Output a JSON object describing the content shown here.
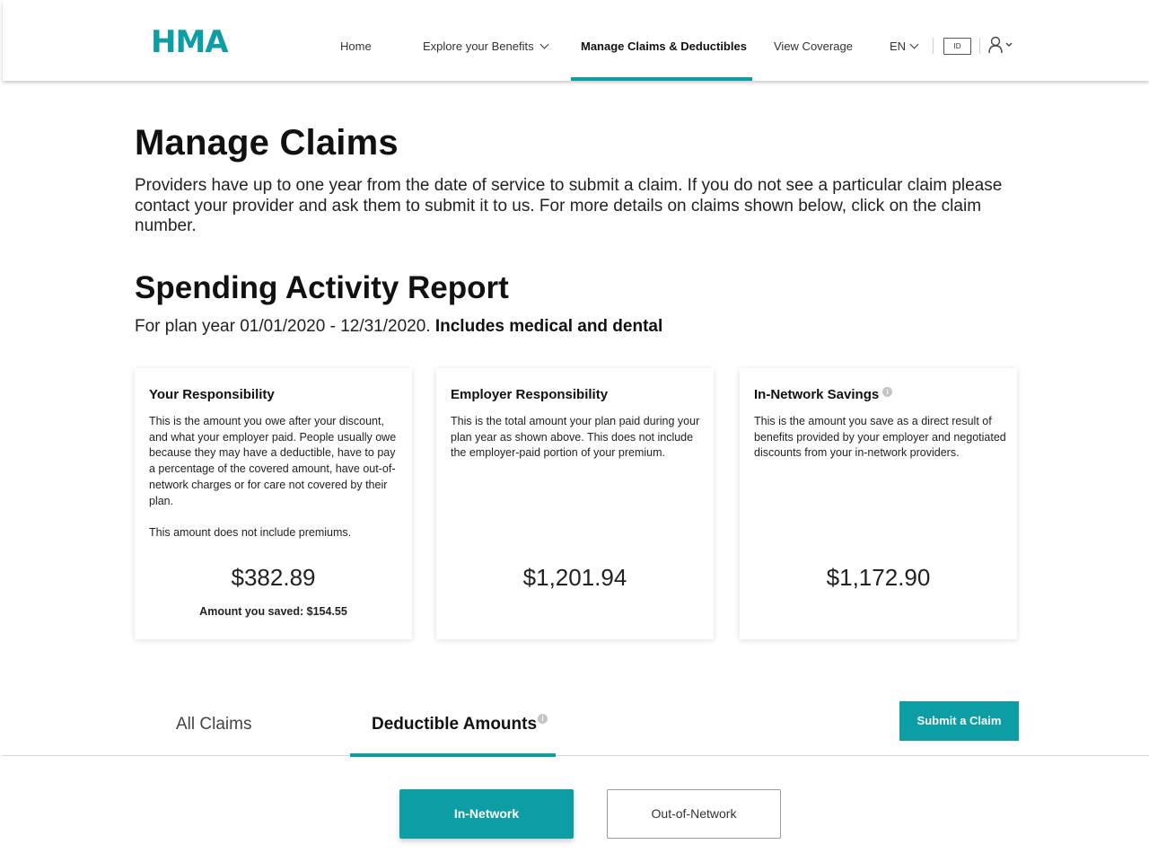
{
  "brand": {
    "logo_text": "HMA",
    "accent_color": "#0d9ea5"
  },
  "nav": {
    "items": [
      {
        "label": "Home"
      },
      {
        "label": "Explore your Benefits",
        "icon": "chevron-down-icon"
      },
      {
        "label": "Manage Claims & Deductibles",
        "active": true
      },
      {
        "label": "View Coverage"
      }
    ],
    "language": {
      "label": "EN",
      "icon": "chevron-down-icon"
    },
    "id_card_label": "ID",
    "user_icon": "user-icon"
  },
  "page": {
    "title": "Manage Claims",
    "intro": "Providers have up to one year from the date of service to submit a claim. If you do not see a particular claim please contact your provider and ask them to submit it to us. For more details on claims shown below, click on the claim number."
  },
  "report": {
    "title": "Spending Activity Report",
    "plan_prefix": "For plan year 01/01/2020 - 12/31/2020.",
    "plan_suffix": "Includes medical and dental"
  },
  "cards": [
    {
      "title": "Your Responsibility",
      "description": "This is the amount you owe after your discount, and what your employer paid. People usually owe because they may have a deductible, have to pay a percentage of the covered amount, have out-of-network charges or for care not covered by their plan.",
      "note": "This amount does not include premiums.",
      "amount": "$382.89",
      "saved": "Amount you saved: $154.55"
    },
    {
      "title": "Employer Responsibility",
      "description": "This is the total amount your plan paid during your plan year as shown above. This does not include the employer-paid portion of your premium.",
      "amount": "$1,201.94"
    },
    {
      "title": "In-Network Savings",
      "info_icon": "info-icon",
      "description": "This is the amount you save as a direct result of benefits provided by your employer and negotiated discounts from your in-network providers.",
      "amount": "$1,172.90"
    }
  ],
  "tabs": [
    {
      "label": "All Claims",
      "active": false
    },
    {
      "label": "Deductible Amounts",
      "active": true,
      "info_icon": "info-icon"
    }
  ],
  "actions": {
    "submit_claim": "Submit a Claim"
  },
  "network_toggle": {
    "options": [
      {
        "label": "In-Network",
        "selected": true
      },
      {
        "label": "Out-of-Network",
        "selected": false
      }
    ]
  }
}
